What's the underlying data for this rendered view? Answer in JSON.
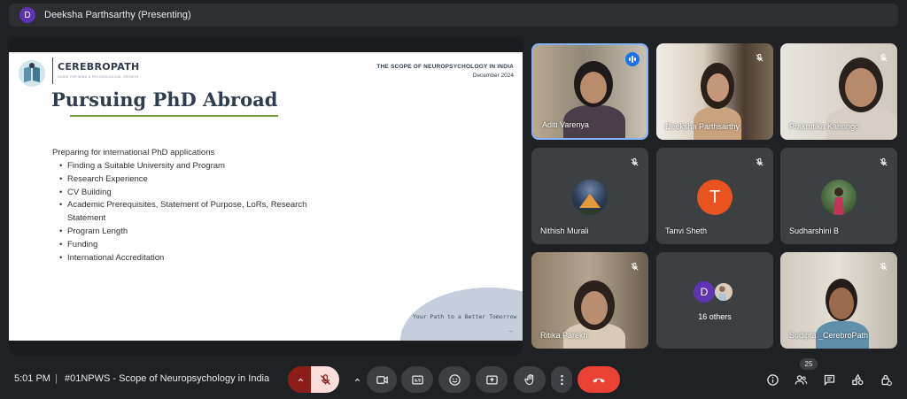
{
  "presenter": {
    "avatar_letter": "D",
    "label": "Deeksha Parthsarthy (Presenting)"
  },
  "slide": {
    "brand": "CEREBROPATH",
    "brand_sub": "GUIDE FOR MIND & PSYCHOLOGICAL GROWTH",
    "topic": "THE SCOPE OF NEUROPSYCHOLOGY IN INDIA",
    "date": "December 2024",
    "title": "Pursuing PhD Abroad",
    "intro": "Preparing for international PhD applications",
    "bullets": [
      "Finding a Suitable University and Program",
      "Research Experience",
      "CV Building",
      "Academic Prerequisites, Statement of Purpose, LoRs, Research Statement",
      "Program Length",
      "Funding",
      "International Accreditation"
    ],
    "tagline": "Your Path to a Better Tomorrow",
    "footer_dots": "...",
    "colors": {
      "accent_rule": "#7a9a3e",
      "heading": "#2f3d4f",
      "blob": "#c5ceda"
    }
  },
  "participants": {
    "aditi": {
      "name": "Aditi Varenya",
      "speaking": true
    },
    "deeksha": {
      "name": "Deeksha Parthsarthy",
      "muted": true
    },
    "prakrutika": {
      "name": "Prakrutika Kanungo",
      "muted": true
    },
    "nithish": {
      "name": "Nithish Murali",
      "muted": true
    },
    "tanvi": {
      "name": "Tanvi Sheth",
      "avatar_letter": "T",
      "avatar_color": "#e8531f",
      "muted": true
    },
    "sudharshini": {
      "name": "Sudharshini B",
      "muted": true
    },
    "ritika": {
      "name": "Ritika Parekh",
      "muted": true
    },
    "others": {
      "label": "16 others",
      "avatar_letter": "D"
    },
    "sudipta": {
      "name": "Sudipta _CerebroPath",
      "muted": true
    }
  },
  "toolbar": {
    "time": "5:01 PM",
    "separator": "|",
    "meeting_title": "#01NPWS - Scope of Neuropsychology in India",
    "people_count": "25",
    "icons": [
      "chevron-up-icon",
      "mic-off-icon",
      "camera-icon",
      "captions-icon",
      "emoji-icon",
      "present-icon",
      "raise-hand-icon",
      "more-vert-icon",
      "end-call-icon",
      "info-icon",
      "people-icon",
      "chat-icon",
      "activities-icon",
      "host-controls-icon"
    ],
    "colors": {
      "mic_off_bg": "#f9dedc",
      "end_call": "#ea4335",
      "mic_chevron_bg": "#8c1d18"
    }
  }
}
